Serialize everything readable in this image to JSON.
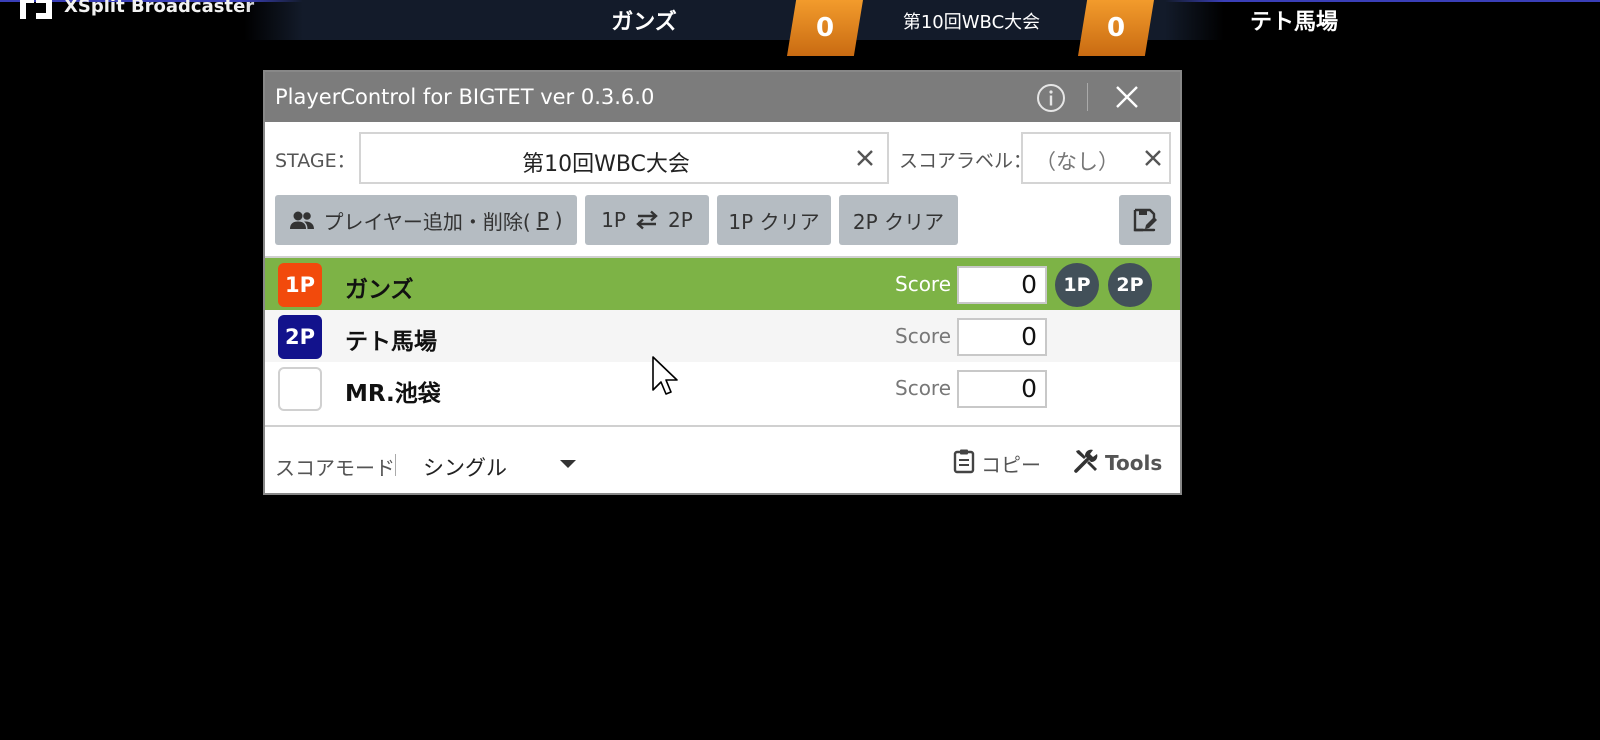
{
  "app": {
    "name": "XSplit Broadcaster"
  },
  "overlay": {
    "p1_name": "ガンズ",
    "p1_score": "0",
    "stage": "第10回WBC大会",
    "p2_score": "0",
    "p2_name": "テト馬場",
    "accent": "#e8891f"
  },
  "dialog": {
    "title": "PlayerControl for BIGTET ver 0.3.6.0",
    "stage_label": "STAGE：",
    "stage_value": "第10回WBC大会",
    "score_label_label": "スコアラベル：",
    "score_label_value": "（なし）",
    "buttons": {
      "add_remove": "プレイヤー追加・削除(",
      "add_remove_key": "P",
      "add_remove_end": ")",
      "swap_left": "1P",
      "swap_right": "2P",
      "clear_1p": "1P クリア",
      "clear_2p": "2P クリア"
    },
    "players": [
      {
        "badge": "1P",
        "name": "ガンズ",
        "score_label": "Score",
        "score": "0"
      },
      {
        "badge": "2P",
        "name": "テト馬場",
        "score_label": "Score",
        "score": "0"
      },
      {
        "badge": "",
        "name": "MR.池袋",
        "score_label": "Score",
        "score": "0"
      }
    ],
    "assign_1p": "1P",
    "assign_2p": "2P",
    "footer": {
      "mode_label": "スコアモード",
      "mode_value": "シングル",
      "copy": "コピー",
      "tools": "Tools"
    },
    "colors": {
      "selected_row": "#7db346",
      "p1_badge": "#f24a0c",
      "p2_badge": "#12128c",
      "button": "#b5bcc2"
    }
  }
}
